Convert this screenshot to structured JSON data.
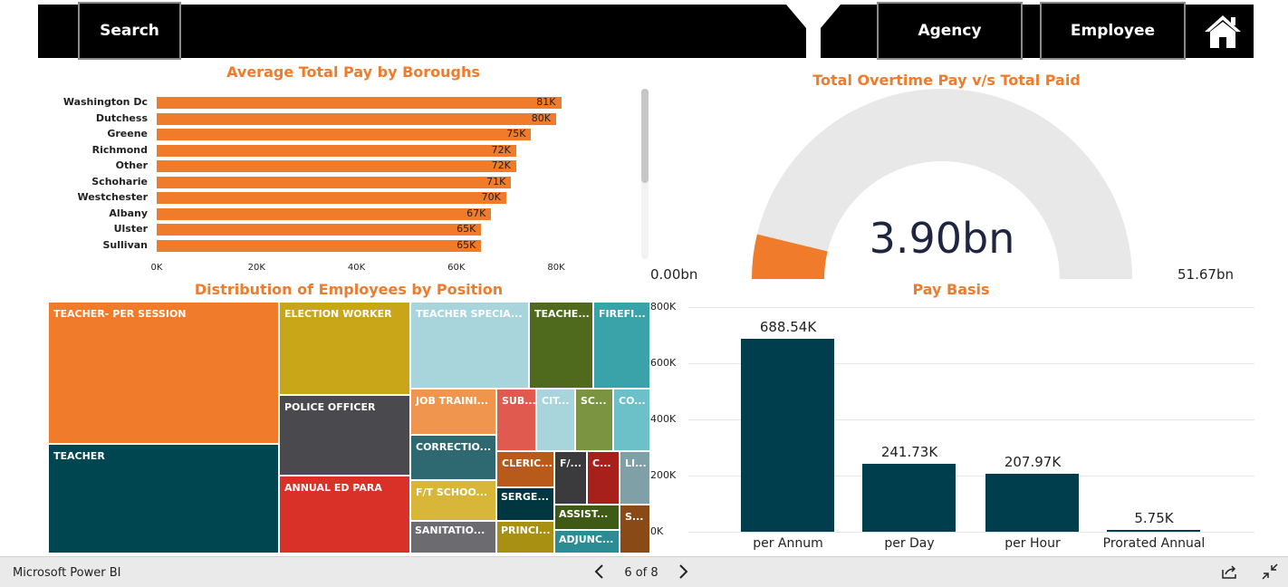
{
  "topbar": {
    "search_label": "Search",
    "agency_label": "Agency",
    "employee_label": "Employee",
    "filter_icon": "filter-funnel-icon",
    "home_icon": "home-icon"
  },
  "boroughs_chart": {
    "title": "Average Total Pay by Boroughs",
    "chart_data": {
      "type": "bar",
      "orientation": "horizontal",
      "categories": [
        "Washington Dc",
        "Dutchess",
        "Greene",
        "Richmond",
        "Other",
        "Schoharie",
        "Westchester",
        "Albany",
        "Ulster",
        "Sullivan"
      ],
      "values": [
        81000,
        80000,
        75000,
        72000,
        72000,
        71000,
        70000,
        67000,
        65000,
        65000
      ],
      "value_labels": [
        "81K",
        "80K",
        "75K",
        "72K",
        "72K",
        "71K",
        "70K",
        "67K",
        "65K",
        "65K"
      ],
      "xticks": [
        "0K",
        "20K",
        "40K",
        "60K",
        "80K"
      ],
      "xlim": [
        0,
        80000
      ],
      "color": "#f07b2a"
    }
  },
  "gauge": {
    "title": "Total Overtime Pay v/s Total Paid",
    "value_label": "3.90bn",
    "min_label": "0.00bn",
    "max_label": "51.67bn",
    "value": 3.9,
    "min": 0.0,
    "max": 51.67,
    "fill_color": "#f07b2a",
    "track_color": "#e8e8e8"
  },
  "treemap": {
    "title": "Distribution of Employees by Position",
    "cells": [
      {
        "label": "TEACHER- PER SESSION",
        "color": "#f07b2a"
      },
      {
        "label": "TEACHER",
        "color": "#004650"
      },
      {
        "label": "ELECTION WORKER",
        "color": "#c9a518"
      },
      {
        "label": "POLICE OFFICER",
        "color": "#4a4a4e"
      },
      {
        "label": "ANNUAL ED PARA",
        "color": "#d93028"
      },
      {
        "label": "TEACHER SPECIA...",
        "color": "#a8d5dc"
      },
      {
        "label": "TEACHE...",
        "color": "#4f6a1c"
      },
      {
        "label": "FIREFI...",
        "color": "#3aa3aa"
      },
      {
        "label": "JOB TRAINI...",
        "color": "#f0954e"
      },
      {
        "label": "SUB...",
        "color": "#e05a50"
      },
      {
        "label": "CIT...",
        "color": "#a8d5dc"
      },
      {
        "label": "SC...",
        "color": "#7a9442"
      },
      {
        "label": "CO...",
        "color": "#6cc0c8"
      },
      {
        "label": "CORRECTIO...",
        "color": "#2e6870"
      },
      {
        "label": "CLERIC...",
        "color": "#b85a1a"
      },
      {
        "label": "F/...",
        "color": "#3b3b3e"
      },
      {
        "label": "C...",
        "color": "#a8201c"
      },
      {
        "label": "LI...",
        "color": "#7fa0a6"
      },
      {
        "label": "F/T SCHOO...",
        "color": "#d8b63a"
      },
      {
        "label": "SERGE...",
        "color": "#00363f"
      },
      {
        "label": "ASSIST...",
        "color": "#3e5a14"
      },
      {
        "label": "S...",
        "color": "#8a4a18"
      },
      {
        "label": "SANITATIO...",
        "color": "#6b6b70"
      },
      {
        "label": "PRINCI...",
        "color": "#a89012"
      },
      {
        "label": "ADJUNC...",
        "color": "#2c8c94"
      }
    ]
  },
  "paybasis_chart": {
    "title": "Pay Basis",
    "chart_data": {
      "type": "bar",
      "categories": [
        "per Annum",
        "per Day",
        "per Hour",
        "Prorated Annual"
      ],
      "values": [
        688540,
        241730,
        207970,
        5750
      ],
      "value_labels": [
        "688.54K",
        "241.73K",
        "207.97K",
        "5.75K"
      ],
      "yticks": [
        "0K",
        "200K",
        "400K",
        "600K",
        "800K"
      ],
      "ylim": [
        0,
        800000
      ],
      "color": "#003e4d"
    }
  },
  "statusbar": {
    "app_name": "Microsoft Power BI",
    "page_indicator": "6 of 8",
    "prev_icon": "chevron-left-icon",
    "next_icon": "chevron-right-icon",
    "share_icon": "share-icon",
    "fullscreen_icon": "exit-fullscreen-icon"
  }
}
